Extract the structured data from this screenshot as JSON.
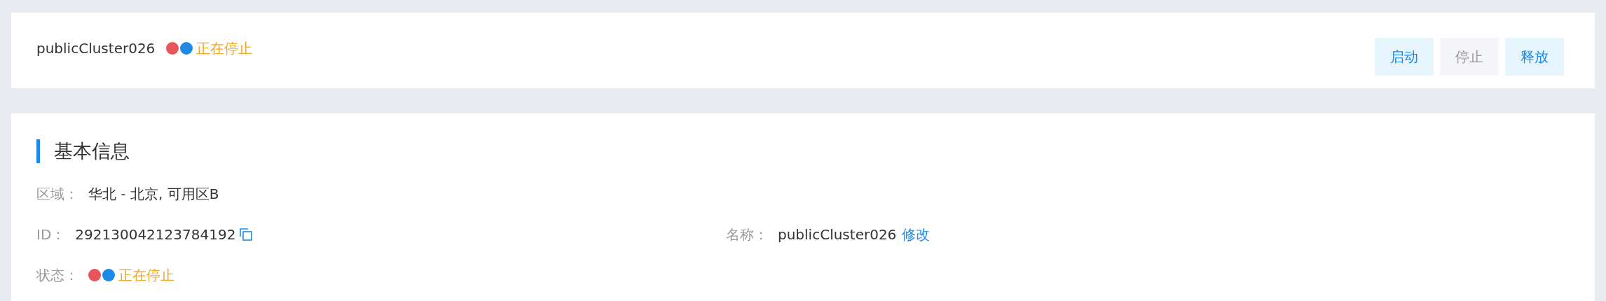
{
  "header": {
    "name": "publicCluster026",
    "status": {
      "text": "正在停止",
      "dots": [
        {
          "color": "#e9545a"
        },
        {
          "color": "#1e8ae8"
        }
      ]
    },
    "buttons": [
      {
        "label": "启动",
        "disabled": false
      },
      {
        "label": "停止",
        "disabled": true
      },
      {
        "label": "释放",
        "disabled": false
      }
    ]
  },
  "basic_info": {
    "title": "基本信息",
    "rows": [
      [
        {
          "kind": "text",
          "label": "区域：",
          "value": "华北 - 北京, 可用区B"
        }
      ],
      [
        {
          "kind": "copy",
          "label": "ID：",
          "value": "292130042123784192"
        },
        {
          "kind": "link",
          "label": "名称：",
          "value": "publicCluster026",
          "link": "修改"
        }
      ],
      [
        {
          "kind": "status",
          "label": "状态：",
          "text": "正在停止",
          "dots": [
            {
              "color": "#e9545a"
            },
            {
              "color": "#1e8ae8"
            }
          ]
        }
      ]
    ]
  }
}
